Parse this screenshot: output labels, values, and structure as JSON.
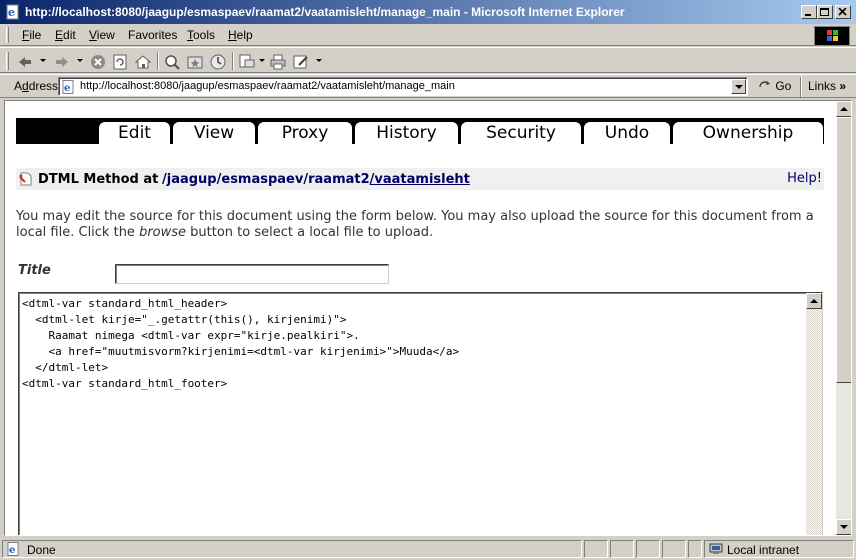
{
  "window": {
    "title": "http://localhost:8080/jaagup/esmaspaev/raamat2/vaatamisleht/manage_main - Microsoft Internet Explorer"
  },
  "menubar": {
    "items": [
      {
        "u": "F",
        "rest": "ile"
      },
      {
        "u": "E",
        "rest": "dit"
      },
      {
        "u": "V",
        "rest": "iew"
      },
      {
        "u": "",
        "rest": "Favorites",
        "pre": "F",
        "prefix": "",
        "full": "Favorites"
      },
      {
        "u": "T",
        "rest": "ools"
      },
      {
        "u": "H",
        "rest": "elp"
      }
    ]
  },
  "addressbar": {
    "label_u": "d",
    "label_pre": "A",
    "label_post": "dress",
    "url": "http://localhost:8080/jaagup/esmaspaev/raamat2/vaatamisleht/manage_main",
    "go_label": "Go",
    "links_label": "Links"
  },
  "tabs": [
    "Edit",
    "View",
    "Proxy",
    "History",
    "Security",
    "Undo",
    "Ownership"
  ],
  "pathbar": {
    "type_label": "DTML Method at",
    "crumbs": [
      "/jaagup",
      "/esmaspaev",
      "/raamat2",
      "/vaatamisleht"
    ],
    "help_label": "Help!"
  },
  "description": {
    "part1": "You may edit the source for this document using the form below. You may also upload the source for this document from a local file. Click the ",
    "italic": "browse",
    "part2": " button to select a local file to upload."
  },
  "form": {
    "title_label": "Title",
    "title_value": "",
    "source": "<dtml-var standard_html_header>\n  <dtml-let kirje=\"_.getattr(this(), kirjenimi)\">\n    Raamat nimega <dtml-var expr=\"kirje.pealkiri\">.\n    <a href=\"muutmisvorm?kirjenimi=<dtml-var kirjenimi>\">Muuda</a>\n  </dtml-let>\n<dtml-var standard_html_footer>"
  },
  "statusbar": {
    "status": "Done",
    "zone": "Local intranet"
  }
}
